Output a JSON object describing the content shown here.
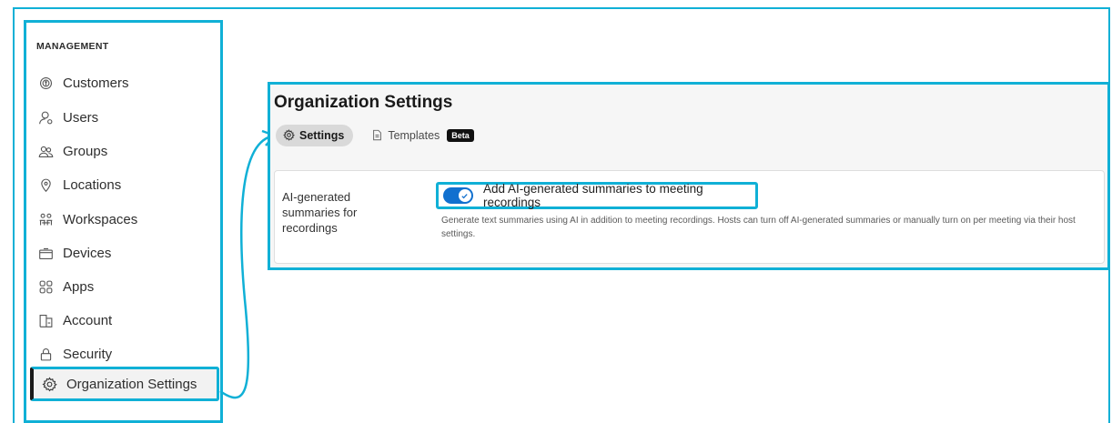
{
  "sidebar": {
    "section_label": "MANAGEMENT",
    "items": [
      {
        "label": "Customers",
        "icon": "customers-icon"
      },
      {
        "label": "Users",
        "icon": "user-icon"
      },
      {
        "label": "Groups",
        "icon": "groups-icon"
      },
      {
        "label": "Locations",
        "icon": "location-pin-icon"
      },
      {
        "label": "Workspaces",
        "icon": "workspaces-icon"
      },
      {
        "label": "Devices",
        "icon": "devices-icon"
      },
      {
        "label": "Apps",
        "icon": "apps-icon"
      },
      {
        "label": "Account",
        "icon": "account-icon"
      },
      {
        "label": "Security",
        "icon": "lock-icon"
      },
      {
        "label": "Organization Settings",
        "icon": "gear-icon",
        "active": true
      }
    ]
  },
  "main": {
    "title": "Organization Settings",
    "tabs": [
      {
        "label": "Settings",
        "icon": "gear-icon",
        "active": true
      },
      {
        "label": "Templates",
        "icon": "document-icon",
        "badge": "Beta"
      }
    ],
    "setting": {
      "label": "AI-generated summaries for recordings",
      "toggle_label": "Add AI-generated summaries to meeting recordings",
      "toggle_on": true,
      "description": "Generate text summaries using AI in addition to meeting recordings. Hosts can turn off AI-generated summaries or manually turn on per meeting via their host settings."
    }
  },
  "colors": {
    "highlight": "#10b0d6",
    "toggle_on": "#1170cf",
    "active_bar": "#1a1a1a"
  }
}
